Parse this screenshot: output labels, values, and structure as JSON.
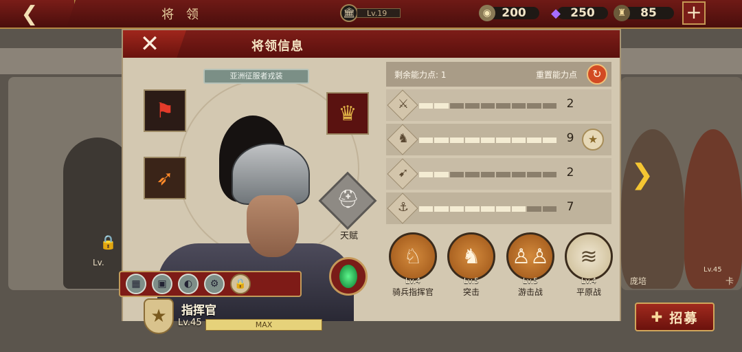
{
  "topbar": {
    "back_icon": "chevron-left-icon",
    "title": "将 领",
    "player_level": "Lv.19",
    "resources": [
      {
        "icon": "coin-icon",
        "value": "200",
        "color": "#c9a85e"
      },
      {
        "icon": "gem-icon",
        "value": "250",
        "color": "#8a4bd8"
      },
      {
        "icon": "honor-icon",
        "value": "85",
        "color": "#c9a85e"
      }
    ],
    "add_label": "+"
  },
  "background": {
    "locked_lv": "Lv.",
    "neighbor_names": [
      "庞培",
      "卡"
    ],
    "neighbor_lv": "Lv.45",
    "next_arrow": "❯",
    "recruit_label": "招募"
  },
  "panel": {
    "title": "将领信息",
    "close": "✕",
    "costume": "亚洲征服者戎装",
    "talent_label": "天赋",
    "hero": {
      "rank_title": "指挥官",
      "level": "Lv.45",
      "exp_label": "MAX"
    },
    "stats": {
      "points_label": "剩余能力点: 1",
      "reset_label": "重置能力点",
      "rows": [
        {
          "icon": "sword-icon",
          "value": "2",
          "fill": 2,
          "segments": 9
        },
        {
          "icon": "horse-icon",
          "value": "9",
          "fill": 9,
          "segments": 9,
          "badge": "star-medal-icon"
        },
        {
          "icon": "bow-icon",
          "value": "2",
          "fill": 2,
          "segments": 9
        },
        {
          "icon": "anchor-icon",
          "value": "7",
          "fill": 7,
          "segments": 9
        }
      ]
    },
    "tactics": [
      {
        "level": "Lv.4",
        "name": "骑兵指挥官",
        "icon": "horse-head-icon"
      },
      {
        "level": "Lv.5",
        "name": "突击",
        "icon": "cavalry-charge-icon"
      },
      {
        "level": "Lv.5",
        "name": "游击战",
        "icon": "skirmish-icon"
      },
      {
        "level": "Lv.4",
        "name": "平原战",
        "icon": "plains-icon"
      }
    ]
  }
}
